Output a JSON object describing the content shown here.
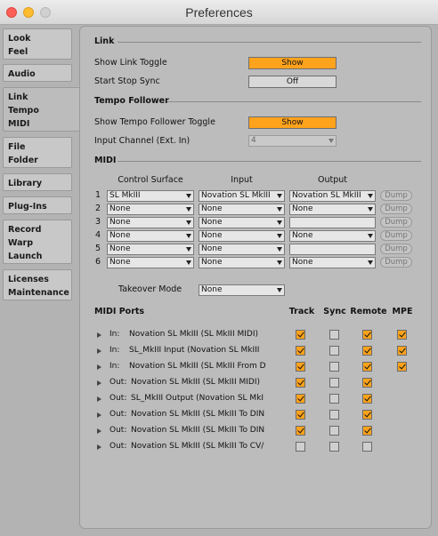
{
  "window": {
    "title": "Preferences"
  },
  "sidebar": {
    "tabs": [
      {
        "label": "Look\nFeel"
      },
      {
        "label": "Audio"
      },
      {
        "label": "Link\nTempo\nMIDI"
      },
      {
        "label": "File\nFolder"
      },
      {
        "label": "Library"
      },
      {
        "label": "Plug-Ins"
      },
      {
        "label": "Record\nWarp\nLaunch"
      },
      {
        "label": "Licenses\nMaintenance"
      }
    ]
  },
  "link": {
    "title": "Link",
    "show_link_toggle_label": "Show Link Toggle",
    "show_link_toggle_value": "Show",
    "start_stop_sync_label": "Start Stop Sync",
    "start_stop_sync_value": "Off"
  },
  "tempo": {
    "title": "Tempo Follower",
    "show_toggle_label": "Show Tempo Follower Toggle",
    "show_toggle_value": "Show",
    "input_channel_label": "Input Channel (Ext. In)",
    "input_channel_value": "4"
  },
  "midi": {
    "title": "MIDI",
    "col_control_surface": "Control Surface",
    "col_input": "Input",
    "col_output": "Output",
    "dump_label": "Dump",
    "rows": [
      {
        "num": "1",
        "surface": "SL MkIII",
        "input": "Novation SL MkIII",
        "output": "Novation SL MkIII"
      },
      {
        "num": "2",
        "surface": "None",
        "input": "None",
        "output": "None"
      },
      {
        "num": "3",
        "surface": "None",
        "input": "None",
        "output": ""
      },
      {
        "num": "4",
        "surface": "None",
        "input": "None",
        "output": "None"
      },
      {
        "num": "5",
        "surface": "None",
        "input": "None",
        "output": ""
      },
      {
        "num": "6",
        "surface": "None",
        "input": "None",
        "output": "None"
      }
    ],
    "takeover_label": "Takeover Mode",
    "takeover_value": "None"
  },
  "ports": {
    "title": "MIDI Ports",
    "col_track": "Track",
    "col_sync": "Sync",
    "col_remote": "Remote",
    "col_mpe": "MPE",
    "rows": [
      {
        "dir": "In:",
        "name": "Novation SL MkIII (SL MkIII MIDI)",
        "track": true,
        "sync": false,
        "remote": true,
        "mpe": true
      },
      {
        "dir": "In:",
        "name": "SL_MkIII Input (Novation SL MkIII",
        "track": true,
        "sync": false,
        "remote": true,
        "mpe": true
      },
      {
        "dir": "In:",
        "name": "Novation SL MkIII (SL MkIII From D",
        "track": true,
        "sync": false,
        "remote": true,
        "mpe": true
      },
      {
        "dir": "Out:",
        "name": "Novation SL MkIII (SL MkIII MIDI)",
        "track": true,
        "sync": false,
        "remote": true,
        "mpe": null
      },
      {
        "dir": "Out:",
        "name": "SL_MkIII Output (Novation SL MkI",
        "track": true,
        "sync": false,
        "remote": true,
        "mpe": null
      },
      {
        "dir": "Out:",
        "name": "Novation SL MkIII (SL MkIII To DIN",
        "track": true,
        "sync": false,
        "remote": true,
        "mpe": null
      },
      {
        "dir": "Out:",
        "name": "Novation SL MkIII (SL MkIII To DIN",
        "track": true,
        "sync": false,
        "remote": true,
        "mpe": null
      },
      {
        "dir": "Out:",
        "name": "Novation SL MkIII (SL MkIII To CV/",
        "track": false,
        "sync": false,
        "remote": false,
        "mpe": null
      }
    ]
  },
  "colors": {
    "accent": "#ffa21c",
    "panel": "#bcbcbc",
    "background": "#b3b3b3"
  },
  "icons": [
    "close-window-icon",
    "minimize-window-icon",
    "zoom-window-icon",
    "chevron-down-icon",
    "disclosure-triangle-icon",
    "checkmark-icon"
  ]
}
